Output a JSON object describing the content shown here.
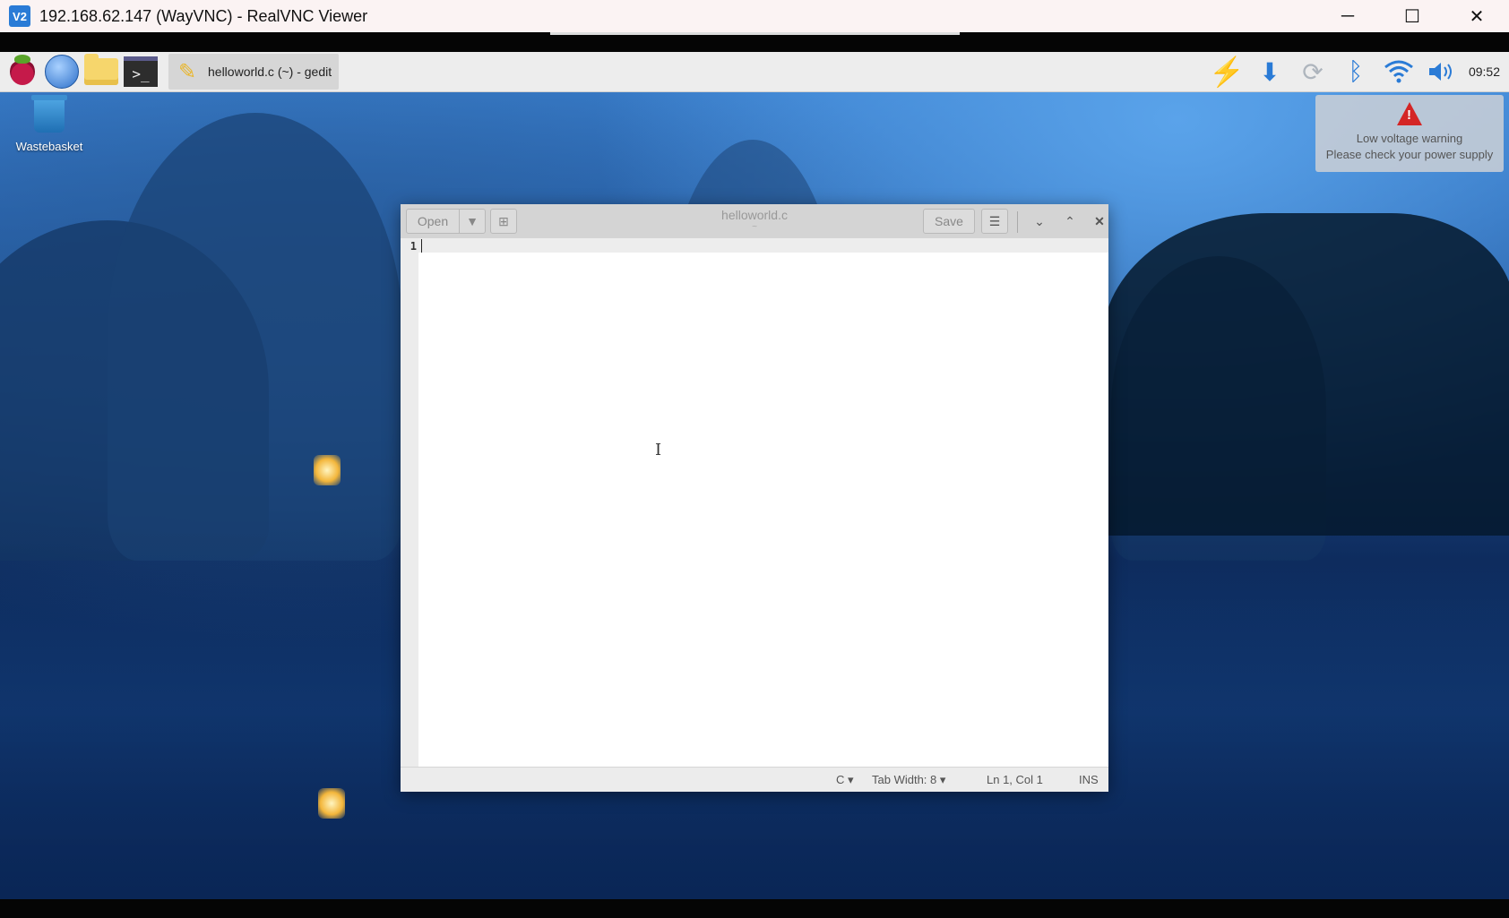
{
  "vnc": {
    "title": "192.168.62.147 (WayVNC) - RealVNC Viewer",
    "logo": "V2",
    "controls": {
      "minimize": "─",
      "maximize": "☐",
      "close": "✕"
    }
  },
  "taskbar": {
    "launchers": [
      "raspberry-pi-menu-icon",
      "web-browser-icon",
      "file-manager-icon",
      "terminal-icon"
    ],
    "terminal_glyph": ">_",
    "task": {
      "label": "helloworld.c (~) - gedit",
      "icon": "pencil-icon"
    },
    "tray": [
      "lightning-bolt-icon",
      "download-updates-icon",
      "network-sync-icon",
      "bluetooth-icon",
      "wifi-icon",
      "volume-icon"
    ],
    "clock": "09:52"
  },
  "desktop": {
    "wastebasket_label": "Wastebasket"
  },
  "notification": {
    "line1": "Low voltage warning",
    "line2": "Please check your power supply"
  },
  "gedit": {
    "open_label": "Open",
    "save_label": "Save",
    "title": "helloworld.c",
    "subtitle": "~",
    "line_numbers": [
      "1"
    ],
    "status": {
      "language": "C ▾",
      "tab_width": "Tab Width: 8 ▾",
      "position": "Ln 1, Col 1",
      "mode": "INS"
    }
  },
  "colors": {
    "accent": "#2a7bd6",
    "warning": "#d42525",
    "bolt": "#f5c518"
  }
}
